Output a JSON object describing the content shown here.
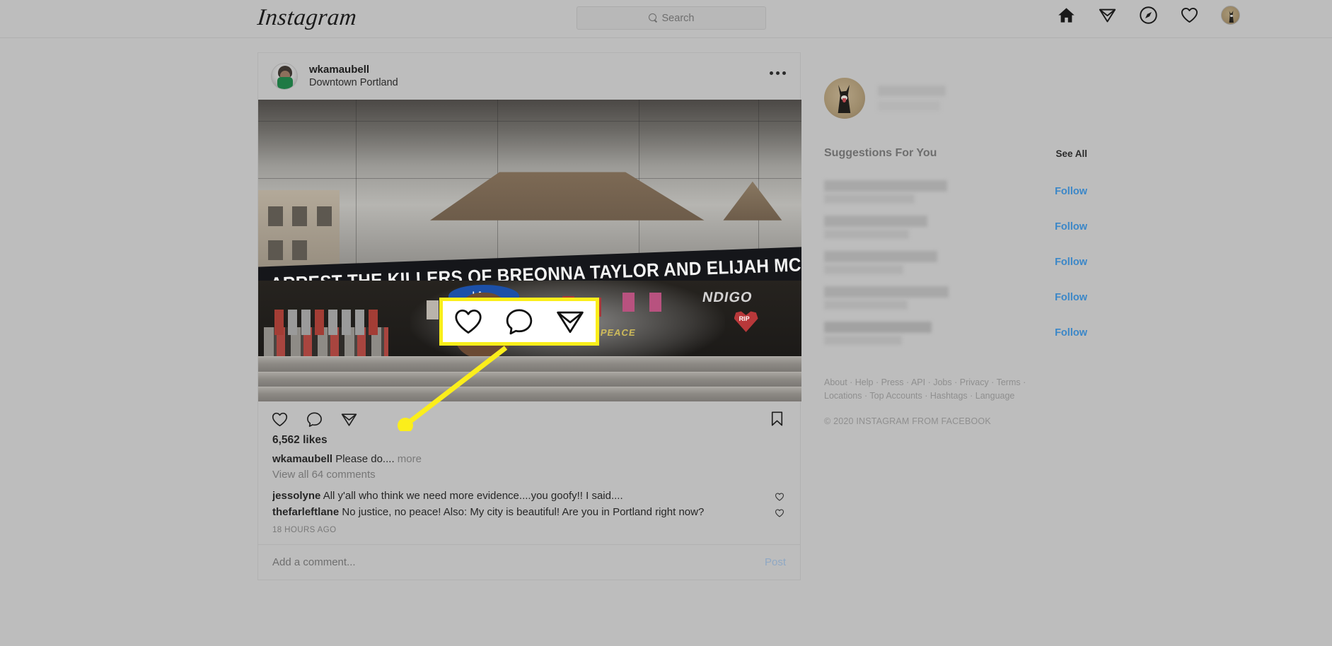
{
  "header": {
    "logo": "Instagram",
    "search": {
      "placeholder": "Search",
      "value": "",
      "icon": "search-icon"
    },
    "nav": [
      {
        "name": "home-icon",
        "label": "Home"
      },
      {
        "name": "direct-messages-icon",
        "label": "Direct"
      },
      {
        "name": "explore-compass-icon",
        "label": "Explore"
      },
      {
        "name": "activity-heart-icon",
        "label": "Activity"
      },
      {
        "name": "profile-avatar",
        "label": "Profile"
      }
    ]
  },
  "post": {
    "username": "wkamaubell",
    "location": "Downtown Portland",
    "more_options_label": "•••",
    "photo_alt": "Mural wall with protest banner",
    "photo_banner_text": "ARREST THE KILLERS OF BREONNA TAYLOR AND ELIJAH MCCLAIN",
    "photo_graffiti": [
      "NDIGO",
      "RIP",
      "PEACE"
    ],
    "actions": {
      "like_label": "Like",
      "comment_label": "Comment",
      "share_label": "Share",
      "save_label": "Save"
    },
    "likes": "6,562 likes",
    "caption_user": "wkamaubell",
    "caption_text": "Please do....",
    "caption_more": "more",
    "view_comments": "View all 64 comments",
    "comments": [
      {
        "user": "jessolyne",
        "text": "All y'all who think we need more evidence....you goofy!! I said...."
      },
      {
        "user": "thefarleftlane",
        "text": "No justice, no peace! Also: My city is beautiful! Are you in Portland right now?"
      }
    ],
    "timeago": "18 HOURS AGO",
    "add_comment_placeholder": "Add a comment...",
    "add_comment_value": "",
    "post_button": "Post"
  },
  "sidebar": {
    "suggestions_title": "Suggestions For You",
    "see_all": "See All",
    "follow_label": "Follow",
    "suggestion_count": 5,
    "footer_links": "About · Help · Press · API · Jobs · Privacy · Terms · Locations · Top Accounts · Hashtags · Language",
    "footer_copyright": "© 2020 INSTAGRAM FROM FACEBOOK"
  },
  "annotation": {
    "highlight_color": "#fbee1b",
    "target": "post-action-icons",
    "icons": [
      "heart-icon",
      "comment-icon",
      "share-icon"
    ]
  },
  "colors": {
    "background": "#bdbdbd",
    "accent_blue": "#3b87c8",
    "highlight_yellow": "#fbee1b",
    "text": "#262626"
  }
}
